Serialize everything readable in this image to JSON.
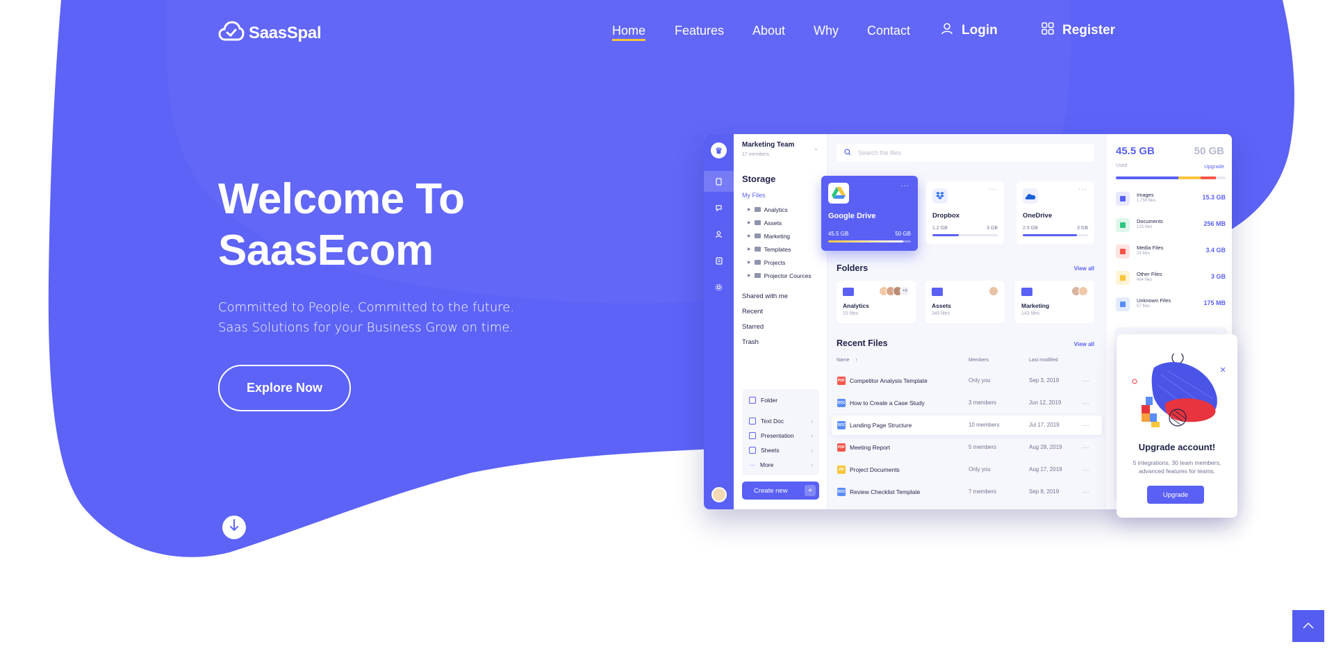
{
  "brand": {
    "name": "SaasSpal"
  },
  "nav": {
    "home": "Home",
    "features": "Features",
    "about": "About",
    "why": "Why",
    "contact": "Contact",
    "login": "Login",
    "register": "Register"
  },
  "hero": {
    "title_line1": "Welcome To",
    "title_line2": "SaasEcom",
    "subtitle": "Committed to People, Committed to the future. Saas Solutions for your Business Grow on time.",
    "cta": "Explore Now"
  },
  "colors": {
    "brand": "#5d63f7",
    "accent": "#f8c53b",
    "button": "#555cf0"
  },
  "icons": {
    "logo": "cloud-check-icon",
    "login": "user-icon",
    "register": "grid-icon",
    "scroll": "arrow-down-icon",
    "back_top": "chevron-up-icon"
  },
  "dashboard": {
    "team": {
      "name": "Marketing Team",
      "members": "17 members"
    },
    "storage_title": "Storage",
    "my_files": "My Files",
    "tree": [
      "Analytics",
      "Assets",
      "Marketing",
      "Templates",
      "Projects",
      "Projector Cources"
    ],
    "links": [
      "Shared with me",
      "Recent",
      "Starred",
      "Trash"
    ],
    "menu": [
      "Folder",
      "Text Doc",
      "Presentation",
      "Sheets",
      "More"
    ],
    "create_new": "Create new",
    "search_placeholder": "Search the files",
    "clouds": [
      {
        "name": "Google Drive",
        "used": "45.5 GB",
        "total": "50 GB",
        "fill": 0.91
      },
      {
        "name": "Dropbox",
        "used": "1.2 GB",
        "total": "3 GB",
        "fill": 0.4
      },
      {
        "name": "OneDrive",
        "used": "2.5 GB",
        "total": "3 GB",
        "fill": 0.83
      }
    ],
    "folders_title": "Folders",
    "view_all": "View all",
    "folders": [
      {
        "name": "Analytics",
        "count": "15 files",
        "more": "+4"
      },
      {
        "name": "Assets",
        "count": "345 files"
      },
      {
        "name": "Marketing",
        "count": "143 files"
      }
    ],
    "recent_title": "Recent Files",
    "columns": {
      "name": "Name",
      "members": "Members",
      "modified": "Last modified"
    },
    "files": [
      {
        "name": "Competitor Analysis Template",
        "members": "Only you",
        "date": "Sep 3, 2019",
        "type": "PDF",
        "color": "#f5564a"
      },
      {
        "name": "How to Create a Case Study",
        "members": "3 members",
        "date": "Jun 12, 2019",
        "type": "DOC",
        "color": "#5a8df8"
      },
      {
        "name": "Landing Page Structure",
        "members": "10 members",
        "date": "Jul 17, 2019",
        "type": "DOC",
        "color": "#5a8df8"
      },
      {
        "name": "Meeting Report",
        "members": "5 members",
        "date": "Aug 28, 2019",
        "type": "PDF",
        "color": "#f5564a"
      },
      {
        "name": "Project Documents",
        "members": "Only you",
        "date": "Aug 17, 2019",
        "type": "ZIP",
        "color": "#f8c53b"
      },
      {
        "name": "Review Checklist Template",
        "members": "7 members",
        "date": "Sep 8, 2019",
        "type": "DOC",
        "color": "#5a8df8"
      }
    ],
    "storage": {
      "used": "45.5 GB",
      "total": "50 GB",
      "used_label": "Used",
      "upgrade_label": "Upgrade",
      "types": [
        {
          "name": "Images",
          "count": "1,756 files",
          "size": "15.3 GB",
          "color": "#5a60f4",
          "bg": "#e8e9fd"
        },
        {
          "name": "Documents",
          "count": "123 files",
          "size": "256 MB",
          "color": "#2dc57e",
          "bg": "#dff6ea"
        },
        {
          "name": "Media Files",
          "count": "24 files",
          "size": "3.4 GB",
          "color": "#f5564a",
          "bg": "#fde3e1"
        },
        {
          "name": "Other Files",
          "count": "454 files",
          "size": "3 GB",
          "color": "#f8c53b",
          "bg": "#fff3d6"
        },
        {
          "name": "Unknown Files",
          "count": "57 files",
          "size": "175 MB",
          "color": "#5a8df8",
          "bg": "#e3ebfd"
        }
      ]
    },
    "upgrade": {
      "title": "Upgrade account!",
      "desc": "5 integrations, 30 team members, advanced features for teams.",
      "button": "Upgrade"
    }
  }
}
